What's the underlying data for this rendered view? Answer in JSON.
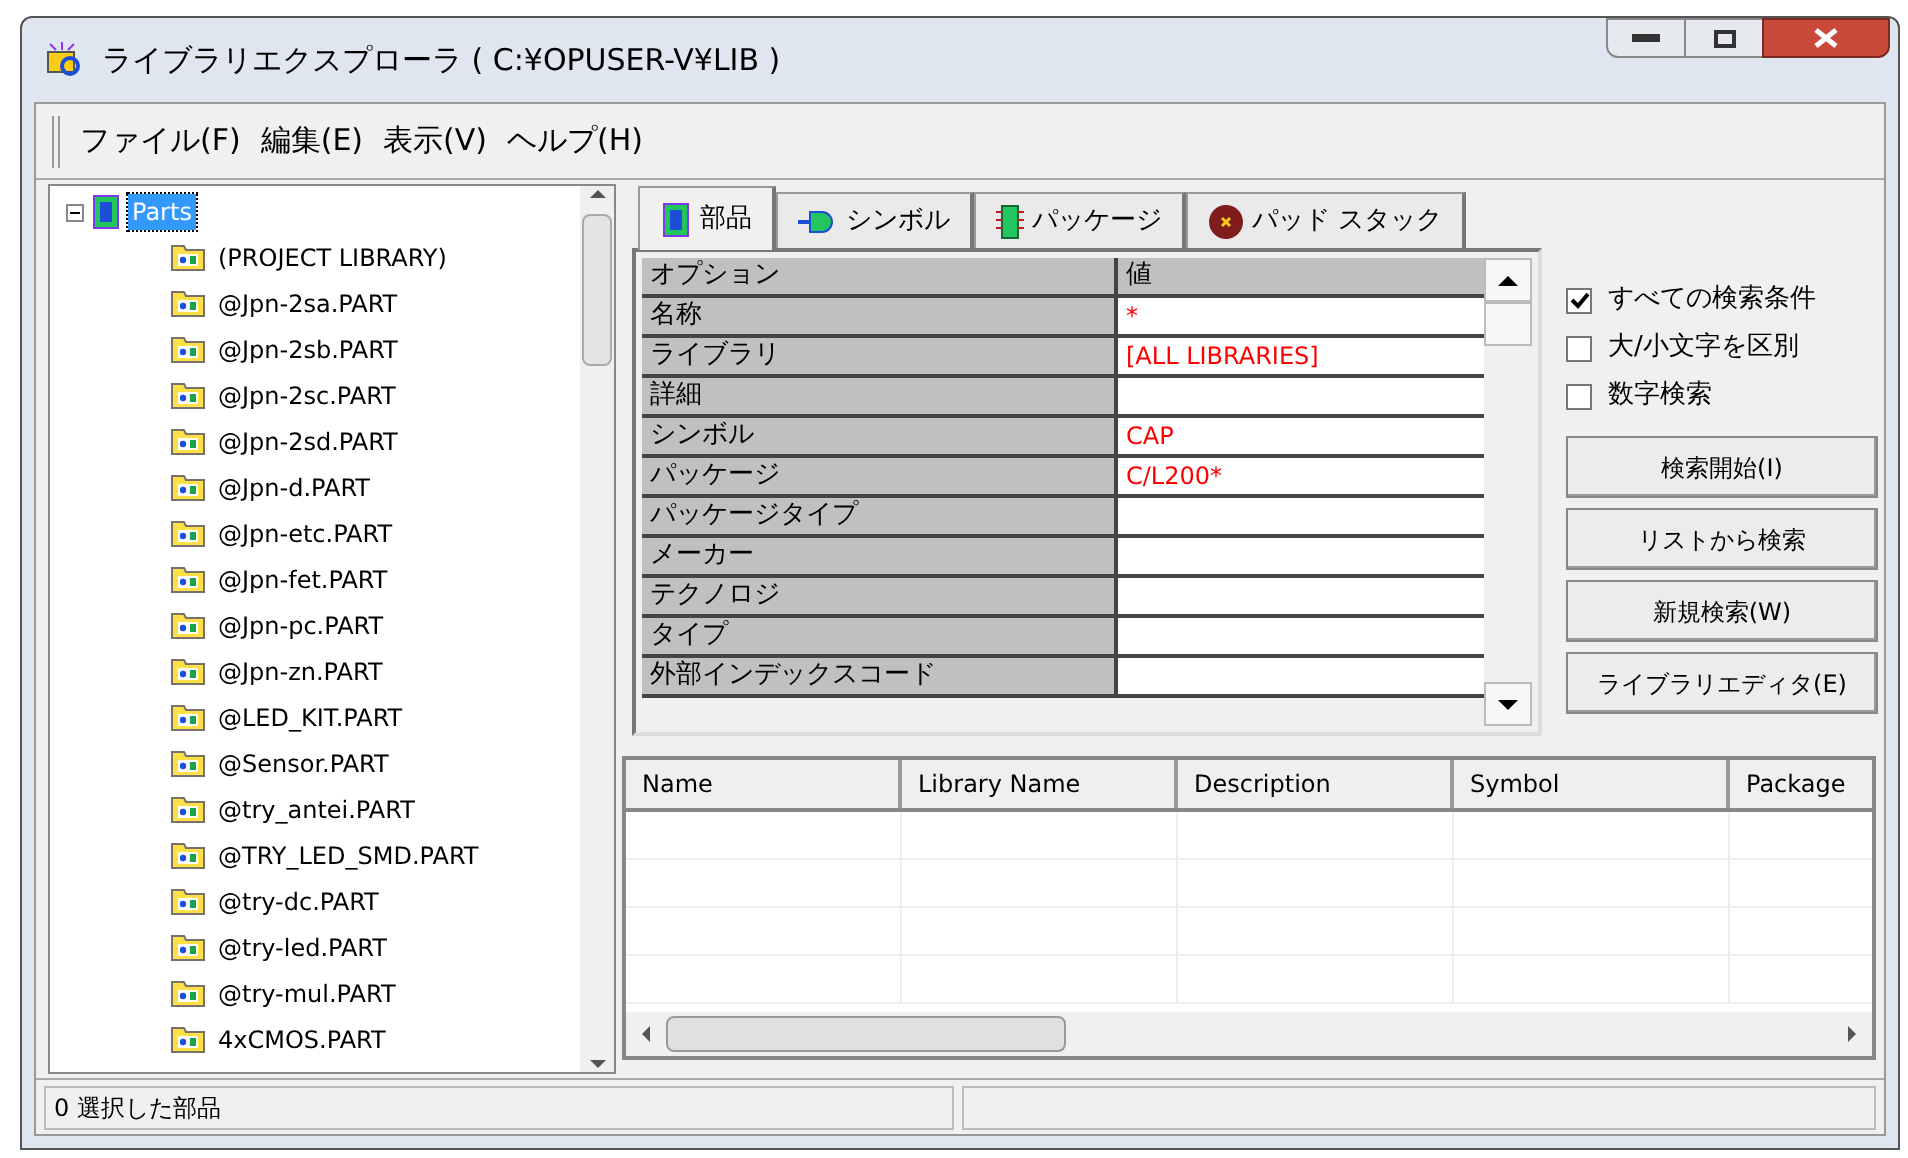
{
  "window": {
    "title": "ライブラリエクスプローラ ( C:¥OPUSER-V¥LIB )"
  },
  "menu": [
    "ファイル(F)",
    "編集(E)",
    "表示(V)",
    "ヘルプ(H)"
  ],
  "tree": {
    "label": "Parts",
    "selected": true,
    "expanded": true,
    "children": [
      {
        "label": "(PROJECT LIBRARY)"
      },
      {
        "label": "@Jpn-2sa.PART"
      },
      {
        "label": "@Jpn-2sb.PART"
      },
      {
        "label": "@Jpn-2sc.PART"
      },
      {
        "label": "@Jpn-2sd.PART"
      },
      {
        "label": "@Jpn-d.PART"
      },
      {
        "label": "@Jpn-etc.PART"
      },
      {
        "label": "@Jpn-fet.PART"
      },
      {
        "label": "@Jpn-pc.PART"
      },
      {
        "label": "@Jpn-zn.PART"
      },
      {
        "label": "@LED_KIT.PART"
      },
      {
        "label": "@Sensor.PART"
      },
      {
        "label": "@try_antei.PART"
      },
      {
        "label": "@TRY_LED_SMD.PART"
      },
      {
        "label": "@try-dc.PART"
      },
      {
        "label": "@try-led.PART"
      },
      {
        "label": "@try-mul.PART"
      },
      {
        "label": "4xCMOS.PART"
      }
    ]
  },
  "tabs": [
    {
      "label": "部品",
      "kind": "part",
      "selected": true
    },
    {
      "label": "シンボル",
      "kind": "symbol",
      "selected": false
    },
    {
      "label": "パッケージ",
      "kind": "package",
      "selected": false
    },
    {
      "label": "パッド スタック",
      "kind": "padstack",
      "selected": false
    }
  ],
  "properties": {
    "columns": [
      "オプション",
      "値"
    ],
    "rows": [
      {
        "name": "名称",
        "value": "*"
      },
      {
        "name": "ライブラリ",
        "value": "[ALL LIBRARIES]"
      },
      {
        "name": "詳細"
      },
      {
        "name": "シンボル",
        "value": "CAP"
      },
      {
        "name": "パッケージ",
        "value": "C/L200*"
      },
      {
        "name": "パッケージタイプ"
      },
      {
        "name": "メーカー"
      },
      {
        "name": "テクノロジ"
      },
      {
        "name": "タイプ"
      },
      {
        "name": "外部インデックスコード"
      }
    ]
  },
  "options": [
    {
      "label": "すべての検索条件",
      "checked": true
    },
    {
      "label": "大/小文字を区別",
      "checked": false
    },
    {
      "label": "数字検索",
      "checked": false
    }
  ],
  "buttons": [
    "検索開始(I)",
    "リストから検索",
    "新規検索(W)",
    "ライブラリエディタ(E)"
  ],
  "results": {
    "columns": [
      "Name",
      "Library Name",
      "Description",
      "Symbol",
      "Package"
    ]
  },
  "status_bar": [
    "0 選択した部品"
  ]
}
